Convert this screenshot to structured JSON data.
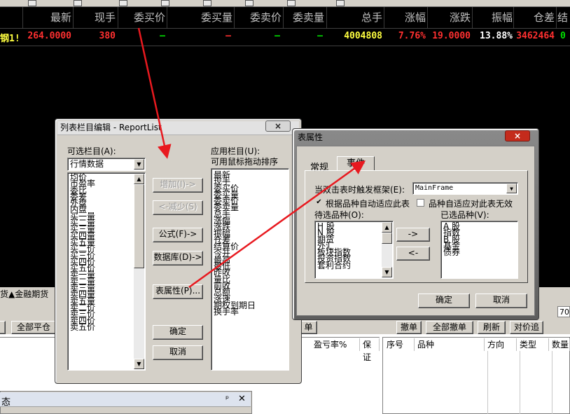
{
  "quote": {
    "headers": [
      "最新",
      "现手",
      "委买价",
      "委买量",
      "委卖价",
      "委卖量",
      "总手",
      "涨幅",
      "涨跌",
      "振幅",
      "仓差",
      "结"
    ],
    "row": {
      "name": "钢1!",
      "last": "264.0000",
      "volume": "380",
      "bid": "—",
      "bid_qty": "—",
      "ask": "—",
      "ask_qty": "—",
      "total": "4004808",
      "change_pct": "7.76%",
      "change": "19.0000",
      "amplitude": "13.88%",
      "oi_change": "3462464",
      "last_col": "0"
    }
  },
  "lower": {
    "tabs": [
      "货",
      "▲金融期货"
    ],
    "left_button": "全部平仓",
    "right_buttons": [
      "撤单",
      "全部撤单",
      "刷新",
      "对价追"
    ],
    "stub_btn": "单",
    "left_columns": [
      "盈亏率%",
      "保证"
    ],
    "right_columns": [
      "序号",
      "品种",
      "方向",
      "类型",
      "数量"
    ],
    "field_value": "70",
    "status_title": "态",
    "pin": "ᵖ",
    "close": "✕"
  },
  "dialog1": {
    "title": "列表栏目编辑 - ReportList",
    "available_label": "可选栏目(A):",
    "category": "行情数据",
    "available_items": [
      "均价",
      "市盈率",
      "委比",
      "委差",
      "外盘",
      "内盘",
      "买一量",
      "买二量",
      "买三量",
      "买四量",
      "买五量",
      "买二价",
      "买三价",
      "买四价",
      "买五价",
      "卖一量",
      "卖二量",
      "卖三量",
      "卖四量",
      "卖五量",
      "卖二价",
      "卖三价",
      "卖四价",
      "卖五价"
    ],
    "applied_label": "应用栏目(U):",
    "drag_hint": "可用鼠标拖动排序",
    "applied_items": [
      "最新",
      "现手",
      "委买价",
      "委买量",
      "委卖价",
      "委卖量",
      "总手",
      "涨幅",
      "涨跌",
      "振幅",
      "仓差",
      "结算价",
      "今开",
      "最高",
      "最低",
      "昨收",
      "量比",
      "前收",
      "总额",
      "涨速",
      "期权到期日",
      "换手率"
    ],
    "add_button": "增加(I)->",
    "remove_button": "<-减少(S)",
    "formula_button": "公式(F)->",
    "database_button": "数据库(D)->",
    "props_button": "表属性(P)...",
    "ok_button": "确定",
    "cancel_button": "取消",
    "close": "×"
  },
  "dialog2": {
    "title": "表属性",
    "tab_general": "常规",
    "tab_events": "事件",
    "frame_label": "当双击表时触发框架(E):",
    "frame_value": "MainFrame",
    "auto_adapt_label": "根据品种自动适应此表",
    "invalid_label": "品种自适应对此表无效",
    "candidate_label": "待选品种(O):",
    "selected_label": "已选品种(V):",
    "candidate_items": [
      "H 股",
      "N 股",
      "期货",
      "外汇",
      "板块指数",
      "投资指数",
      "套利合约"
    ],
    "selected_items": [
      "A 股",
      "指数",
      "B 股",
      "基金",
      "债券"
    ],
    "add_arrow": "->",
    "remove_arrow": "<-",
    "ok_button": "确定",
    "cancel_button": "取消",
    "close": "×"
  },
  "colors": {
    "quote_yellow": "#ffff40",
    "quote_red": "#ff3030",
    "quote_green": "#00e000",
    "annotation_red": "#e8191f",
    "title_gray": "#5a5a5a"
  }
}
